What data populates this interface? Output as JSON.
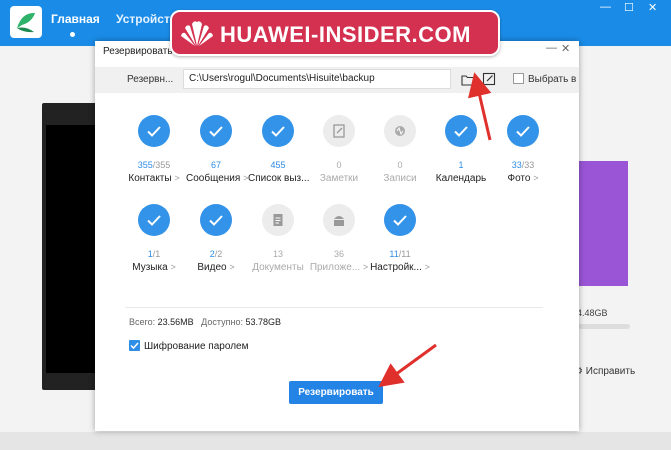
{
  "app": {
    "nav_home": "Главная",
    "nav_devices": "Устройств",
    "storage_text": "4.48GB",
    "fix_label": "Исправить"
  },
  "watermark": {
    "text": "HUAWEI-INSIDER.COM"
  },
  "dialog": {
    "title": "Резервировать",
    "path_label": "Резервн...",
    "path_value": "C:\\Users\\rogul\\Documents\\Hisuite\\backup",
    "select_all": "Выбрать в",
    "items": [
      {
        "label": "Контакты",
        "current": "355",
        "total": "/355",
        "checked": true,
        "arrow": ">"
      },
      {
        "label": "Сообщения",
        "current": "67",
        "total": "",
        "checked": true,
        "arrow": ">"
      },
      {
        "label": "Список выз...",
        "current": "455",
        "total": "",
        "checked": true,
        "arrow": ""
      },
      {
        "label": "Заметки",
        "current": "0",
        "total": "",
        "checked": false,
        "arrow": ""
      },
      {
        "label": "Записи",
        "current": "0",
        "total": "",
        "checked": false,
        "arrow": ""
      },
      {
        "label": "Календарь",
        "current": "1",
        "total": "",
        "checked": true,
        "arrow": ""
      },
      {
        "label": "Фото",
        "current": "33",
        "total": "/33",
        "checked": true,
        "arrow": ">"
      },
      {
        "label": "Музыка",
        "current": "1",
        "total": "/1",
        "checked": true,
        "arrow": ">"
      },
      {
        "label": "Видео",
        "current": "2",
        "total": "/2",
        "checked": true,
        "arrow": ">"
      },
      {
        "label": "Документы",
        "current": "13",
        "total": "",
        "checked": false,
        "arrow": ""
      },
      {
        "label": "Приложе...",
        "current": "36",
        "total": "",
        "checked": false,
        "arrow": ">"
      },
      {
        "label": "Настройк...",
        "current": "11",
        "total": "/11",
        "checked": true,
        "arrow": ">"
      }
    ],
    "total_label": "Всего:",
    "total_value": "23.56MB",
    "avail_label": "Доступно:",
    "avail_value": "53.78GB",
    "encrypt_label": "Шифрование паролем",
    "backup_button": "Резервировать"
  },
  "colors": {
    "accent": "#2f8ee6",
    "topbar": "#1a8ce8",
    "watermark": "#d43050",
    "arrow": "#e0302c"
  },
  "icons": [
    "app-logo-icon",
    "folder-icon",
    "edit-icon",
    "check-icon",
    "notes-icon",
    "recorder-icon",
    "document-icon",
    "android-icon",
    "huawei-logo-icon"
  ]
}
